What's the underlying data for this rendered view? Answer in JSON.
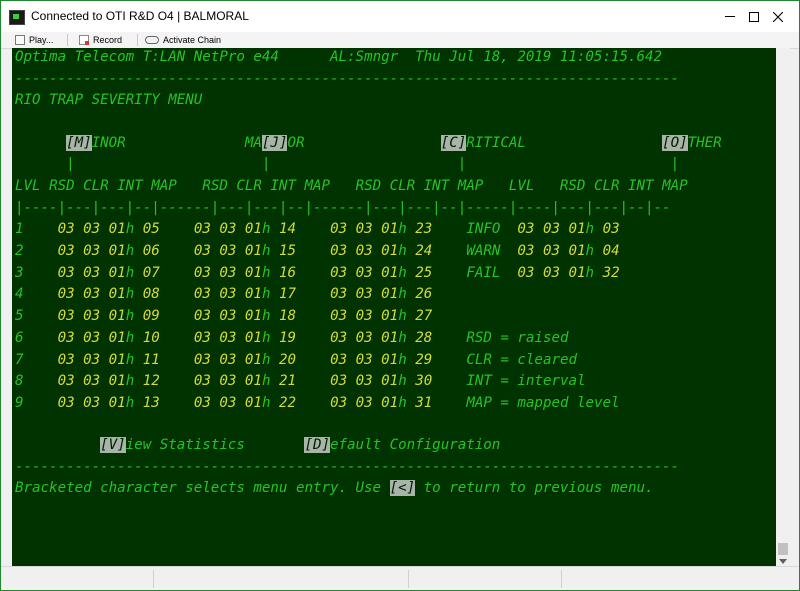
{
  "window": {
    "title": "Connected to OTI R&D O4 | BALMORAL"
  },
  "toolbar": {
    "play_label": "Play...",
    "record_label": "Record",
    "chain_label": "Activate Chain"
  },
  "terminal": {
    "header": {
      "system": "Optima Telecom T:LAN NetPro e44",
      "alarm": "AL:Smngr",
      "datetime": "Thu Jul 18, 2019 11:05:15.642"
    },
    "rule": "------------------------------------------------------------------------------",
    "menu_title": "RIO TRAP SEVERITY MENU",
    "categories": {
      "minor": {
        "key": "[M]",
        "before": "",
        "after": "INOR"
      },
      "major": {
        "key": "[J]",
        "before": "MA",
        "after": "OR"
      },
      "critical": {
        "key": "[C]",
        "before": "",
        "after": "RITICAL"
      },
      "other": {
        "key": "[O]",
        "before": "",
        "after": "THER"
      },
      "tick": "|"
    },
    "columns": {
      "lvl": "LVL",
      "group": "RSD CLR INT MAP"
    },
    "divider": "|----|---|---|--|------|---|---|--|------|---|---|--|-----|----|---|---|--|--",
    "rows": [
      {
        "lvl": "1",
        "minor": [
          "03",
          "03",
          "01",
          "05"
        ],
        "major": [
          "03",
          "03",
          "01",
          "14"
        ],
        "critical": [
          "03",
          "03",
          "01",
          "23"
        ]
      },
      {
        "lvl": "2",
        "minor": [
          "03",
          "03",
          "01",
          "06"
        ],
        "major": [
          "03",
          "03",
          "01",
          "15"
        ],
        "critical": [
          "03",
          "03",
          "01",
          "24"
        ]
      },
      {
        "lvl": "3",
        "minor": [
          "03",
          "03",
          "01",
          "07"
        ],
        "major": [
          "03",
          "03",
          "01",
          "16"
        ],
        "critical": [
          "03",
          "03",
          "01",
          "25"
        ]
      },
      {
        "lvl": "4",
        "minor": [
          "03",
          "03",
          "01",
          "08"
        ],
        "major": [
          "03",
          "03",
          "01",
          "17"
        ],
        "critical": [
          "03",
          "03",
          "01",
          "26"
        ]
      },
      {
        "lvl": "5",
        "minor": [
          "03",
          "03",
          "01",
          "09"
        ],
        "major": [
          "03",
          "03",
          "01",
          "18"
        ],
        "critical": [
          "03",
          "03",
          "01",
          "27"
        ]
      },
      {
        "lvl": "6",
        "minor": [
          "03",
          "03",
          "01",
          "10"
        ],
        "major": [
          "03",
          "03",
          "01",
          "19"
        ],
        "critical": [
          "03",
          "03",
          "01",
          "28"
        ]
      },
      {
        "lvl": "7",
        "minor": [
          "03",
          "03",
          "01",
          "11"
        ],
        "major": [
          "03",
          "03",
          "01",
          "20"
        ],
        "critical": [
          "03",
          "03",
          "01",
          "29"
        ]
      },
      {
        "lvl": "8",
        "minor": [
          "03",
          "03",
          "01",
          "12"
        ],
        "major": [
          "03",
          "03",
          "01",
          "21"
        ],
        "critical": [
          "03",
          "03",
          "01",
          "30"
        ]
      },
      {
        "lvl": "9",
        "minor": [
          "03",
          "03",
          "01",
          "13"
        ],
        "major": [
          "03",
          "03",
          "01",
          "22"
        ],
        "critical": [
          "03",
          "03",
          "01",
          "31"
        ]
      }
    ],
    "interval_suffix": "h",
    "other_rows": [
      {
        "lvl": "INFO",
        "values": [
          "03",
          "03",
          "01",
          "03"
        ]
      },
      {
        "lvl": "WARN",
        "values": [
          "03",
          "03",
          "01",
          "04"
        ]
      },
      {
        "lvl": "FAIL",
        "values": [
          "03",
          "03",
          "01",
          "32"
        ]
      }
    ],
    "legend": [
      "RSD = raised",
      "CLR = cleared",
      "INT = interval",
      "MAP = mapped level"
    ],
    "actions": {
      "view_key": "[V]",
      "view_rest": "iew Statistics",
      "default_key": "[D]",
      "default_rest": "efault Configuration"
    },
    "footer": {
      "before": "Bracketed character selects menu entry. Use ",
      "key": "[<]",
      "after": " to return to previous menu."
    }
  }
}
